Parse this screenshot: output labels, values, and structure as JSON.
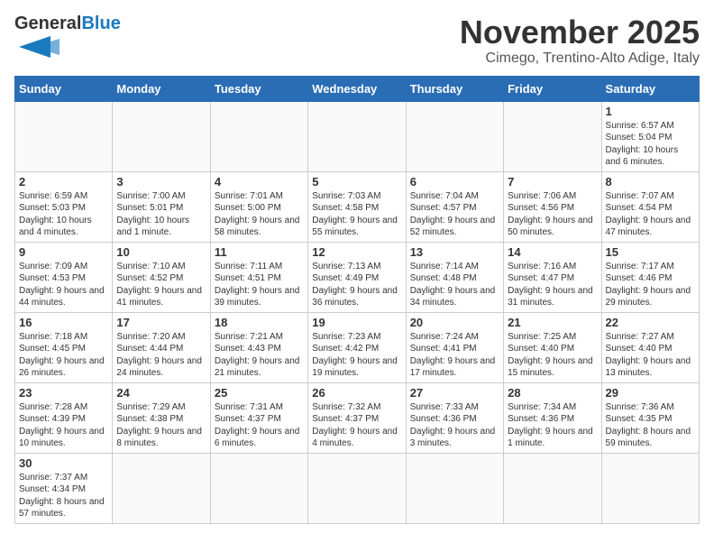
{
  "logo": {
    "text_general": "General",
    "text_blue": "Blue"
  },
  "header": {
    "month": "November 2025",
    "location": "Cimego, Trentino-Alto Adige, Italy"
  },
  "weekdays": [
    "Sunday",
    "Monday",
    "Tuesday",
    "Wednesday",
    "Thursday",
    "Friday",
    "Saturday"
  ],
  "weeks": [
    [
      {
        "day": "",
        "info": ""
      },
      {
        "day": "",
        "info": ""
      },
      {
        "day": "",
        "info": ""
      },
      {
        "day": "",
        "info": ""
      },
      {
        "day": "",
        "info": ""
      },
      {
        "day": "",
        "info": ""
      },
      {
        "day": "1",
        "info": "Sunrise: 6:57 AM\nSunset: 5:04 PM\nDaylight: 10 hours and 6 minutes."
      }
    ],
    [
      {
        "day": "2",
        "info": "Sunrise: 6:59 AM\nSunset: 5:03 PM\nDaylight: 10 hours and 4 minutes."
      },
      {
        "day": "3",
        "info": "Sunrise: 7:00 AM\nSunset: 5:01 PM\nDaylight: 10 hours and 1 minute."
      },
      {
        "day": "4",
        "info": "Sunrise: 7:01 AM\nSunset: 5:00 PM\nDaylight: 9 hours and 58 minutes."
      },
      {
        "day": "5",
        "info": "Sunrise: 7:03 AM\nSunset: 4:58 PM\nDaylight: 9 hours and 55 minutes."
      },
      {
        "day": "6",
        "info": "Sunrise: 7:04 AM\nSunset: 4:57 PM\nDaylight: 9 hours and 52 minutes."
      },
      {
        "day": "7",
        "info": "Sunrise: 7:06 AM\nSunset: 4:56 PM\nDaylight: 9 hours and 50 minutes."
      },
      {
        "day": "8",
        "info": "Sunrise: 7:07 AM\nSunset: 4:54 PM\nDaylight: 9 hours and 47 minutes."
      }
    ],
    [
      {
        "day": "9",
        "info": "Sunrise: 7:09 AM\nSunset: 4:53 PM\nDaylight: 9 hours and 44 minutes."
      },
      {
        "day": "10",
        "info": "Sunrise: 7:10 AM\nSunset: 4:52 PM\nDaylight: 9 hours and 41 minutes."
      },
      {
        "day": "11",
        "info": "Sunrise: 7:11 AM\nSunset: 4:51 PM\nDaylight: 9 hours and 39 minutes."
      },
      {
        "day": "12",
        "info": "Sunrise: 7:13 AM\nSunset: 4:49 PM\nDaylight: 9 hours and 36 minutes."
      },
      {
        "day": "13",
        "info": "Sunrise: 7:14 AM\nSunset: 4:48 PM\nDaylight: 9 hours and 34 minutes."
      },
      {
        "day": "14",
        "info": "Sunrise: 7:16 AM\nSunset: 4:47 PM\nDaylight: 9 hours and 31 minutes."
      },
      {
        "day": "15",
        "info": "Sunrise: 7:17 AM\nSunset: 4:46 PM\nDaylight: 9 hours and 29 minutes."
      }
    ],
    [
      {
        "day": "16",
        "info": "Sunrise: 7:18 AM\nSunset: 4:45 PM\nDaylight: 9 hours and 26 minutes."
      },
      {
        "day": "17",
        "info": "Sunrise: 7:20 AM\nSunset: 4:44 PM\nDaylight: 9 hours and 24 minutes."
      },
      {
        "day": "18",
        "info": "Sunrise: 7:21 AM\nSunset: 4:43 PM\nDaylight: 9 hours and 21 minutes."
      },
      {
        "day": "19",
        "info": "Sunrise: 7:23 AM\nSunset: 4:42 PM\nDaylight: 9 hours and 19 minutes."
      },
      {
        "day": "20",
        "info": "Sunrise: 7:24 AM\nSunset: 4:41 PM\nDaylight: 9 hours and 17 minutes."
      },
      {
        "day": "21",
        "info": "Sunrise: 7:25 AM\nSunset: 4:40 PM\nDaylight: 9 hours and 15 minutes."
      },
      {
        "day": "22",
        "info": "Sunrise: 7:27 AM\nSunset: 4:40 PM\nDaylight: 9 hours and 13 minutes."
      }
    ],
    [
      {
        "day": "23",
        "info": "Sunrise: 7:28 AM\nSunset: 4:39 PM\nDaylight: 9 hours and 10 minutes."
      },
      {
        "day": "24",
        "info": "Sunrise: 7:29 AM\nSunset: 4:38 PM\nDaylight: 9 hours and 8 minutes."
      },
      {
        "day": "25",
        "info": "Sunrise: 7:31 AM\nSunset: 4:37 PM\nDaylight: 9 hours and 6 minutes."
      },
      {
        "day": "26",
        "info": "Sunrise: 7:32 AM\nSunset: 4:37 PM\nDaylight: 9 hours and 4 minutes."
      },
      {
        "day": "27",
        "info": "Sunrise: 7:33 AM\nSunset: 4:36 PM\nDaylight: 9 hours and 3 minutes."
      },
      {
        "day": "28",
        "info": "Sunrise: 7:34 AM\nSunset: 4:36 PM\nDaylight: 9 hours and 1 minute."
      },
      {
        "day": "29",
        "info": "Sunrise: 7:36 AM\nSunset: 4:35 PM\nDaylight: 8 hours and 59 minutes."
      }
    ],
    [
      {
        "day": "30",
        "info": "Sunrise: 7:37 AM\nSunset: 4:34 PM\nDaylight: 8 hours and 57 minutes."
      },
      {
        "day": "",
        "info": ""
      },
      {
        "day": "",
        "info": ""
      },
      {
        "day": "",
        "info": ""
      },
      {
        "day": "",
        "info": ""
      },
      {
        "day": "",
        "info": ""
      },
      {
        "day": "",
        "info": ""
      }
    ]
  ]
}
